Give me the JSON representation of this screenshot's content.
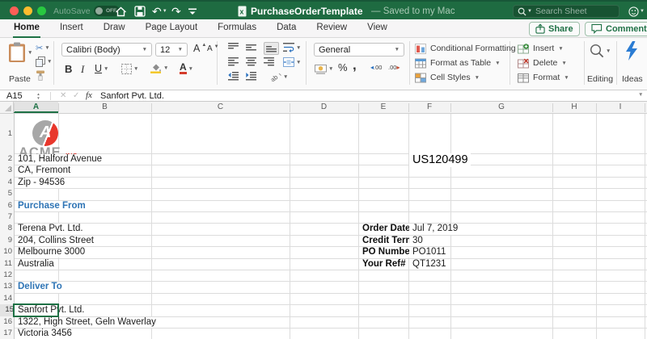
{
  "colors": {
    "titlebar_green": "#1E6B41",
    "accent_green": "#1E7145",
    "heading_blue": "#2E74B5",
    "logo_red": "#E8372C",
    "logo_gray": "#9C9C9C",
    "ideas_blue": "#2B7CD3"
  },
  "titlebar": {
    "autosave_label": "AutoSave",
    "autosave_state": "OFF",
    "doc_title": "PurchaseOrderTemplate",
    "doc_status": "— Saved to my Mac",
    "search_placeholder": "Search Sheet"
  },
  "tabs": {
    "items": [
      {
        "label": "Home",
        "active": true
      },
      {
        "label": "Insert",
        "active": false
      },
      {
        "label": "Draw",
        "active": false
      },
      {
        "label": "Page Layout",
        "active": false
      },
      {
        "label": "Formulas",
        "active": false
      },
      {
        "label": "Data",
        "active": false
      },
      {
        "label": "Review",
        "active": false
      },
      {
        "label": "View",
        "active": false
      }
    ]
  },
  "actions": {
    "share_label": "Share",
    "comments_label": "Comments"
  },
  "ribbon": {
    "paste_label": "Paste",
    "font_name": "Calibri (Body)",
    "font_size": "12",
    "bold": "B",
    "italic": "I",
    "underline": "U",
    "font_color_letter": "A",
    "grow_font": "A",
    "shrink_font": "A",
    "number_format": "General",
    "percent": "%",
    "comma": ",",
    "inc_decimal": ".00",
    "dec_decimal": ".00",
    "styles_group": [
      {
        "label": "Conditional Formatting",
        "icon": "conditional-formatting-icon"
      },
      {
        "label": "Format as Table",
        "icon": "format-as-table-icon"
      },
      {
        "label": "Cell Styles",
        "icon": "cell-styles-icon"
      }
    ],
    "cells_group": [
      {
        "label": "Insert",
        "icon": "insert-cells-icon"
      },
      {
        "label": "Delete",
        "icon": "delete-cells-icon"
      },
      {
        "label": "Format",
        "icon": "format-cells-icon"
      }
    ],
    "editing_label": "Editing",
    "ideas_label": "Ideas"
  },
  "formula_bar": {
    "name_box": "A15",
    "cancel": "✕",
    "accept": "✓",
    "fx": "fx",
    "content": "Sanfort Pvt. Ltd."
  },
  "sheet": {
    "columns": [
      "A",
      "B",
      "C",
      "D",
      "E",
      "F",
      "G",
      "H",
      "I"
    ],
    "row_numbers": [
      1,
      2,
      3,
      4,
      5,
      6,
      7,
      8,
      9,
      10,
      11,
      12,
      13,
      14,
      15,
      16,
      17
    ],
    "selection": {
      "col": "A",
      "row": 15,
      "cell_ref": "A15"
    },
    "logo": {
      "company": "ACME",
      "suffix": "INC.",
      "monogram": "A"
    },
    "cells": [
      {
        "r": 2,
        "col": "A",
        "t": "101, Halford Avenue",
        "s": ""
      },
      {
        "r": 2,
        "col": "F",
        "t": "US120499",
        "s": "big"
      },
      {
        "r": 3,
        "col": "A",
        "t": "CA, Fremont",
        "s": ""
      },
      {
        "r": 4,
        "col": "A",
        "t": "Zip - 94536",
        "s": ""
      },
      {
        "r": 6,
        "col": "A",
        "t": "Purchase From",
        "s": "h"
      },
      {
        "r": 8,
        "col": "A",
        "t": "Terena Pvt. Ltd.",
        "s": ""
      },
      {
        "r": 8,
        "col": "E",
        "t": "Order Date:",
        "s": "b"
      },
      {
        "r": 8,
        "col": "F",
        "t": "Jul 7, 2019",
        "s": ""
      },
      {
        "r": 9,
        "col": "A",
        "t": "204, Collins Street",
        "s": ""
      },
      {
        "r": 9,
        "col": "E",
        "t": "Credit Terms",
        "s": "b"
      },
      {
        "r": 9,
        "col": "F",
        "t": "30",
        "s": ""
      },
      {
        "r": 10,
        "col": "A",
        "t": "Melbourne 3000",
        "s": ""
      },
      {
        "r": 10,
        "col": "E",
        "t": "PO Number",
        "s": "b"
      },
      {
        "r": 10,
        "col": "F",
        "t": "PO1011",
        "s": ""
      },
      {
        "r": 11,
        "col": "A",
        "t": "Australia",
        "s": ""
      },
      {
        "r": 11,
        "col": "E",
        "t": "Your Ref#",
        "s": "b"
      },
      {
        "r": 11,
        "col": "F",
        "t": "QT1231",
        "s": ""
      },
      {
        "r": 13,
        "col": "A",
        "t": "Deliver To",
        "s": "h"
      },
      {
        "r": 15,
        "col": "A",
        "t": "Sanfort Pvt. Ltd.",
        "s": ""
      },
      {
        "r": 16,
        "col": "A",
        "t": "1322, High Street, Geln Waverlay",
        "s": ""
      },
      {
        "r": 17,
        "col": "A",
        "t": "Victoria 3456",
        "s": ""
      }
    ]
  }
}
